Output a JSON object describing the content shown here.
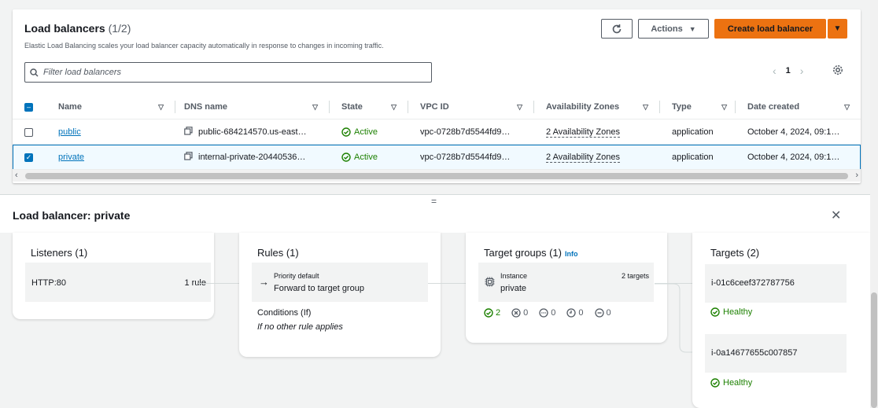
{
  "header": {
    "title": "Load balancers",
    "count": "(1/2)",
    "description": "Elastic Load Balancing scales your load balancer capacity automatically in response to changes in incoming traffic.",
    "actions_label": "Actions",
    "create_label": "Create load balancer"
  },
  "filter": {
    "placeholder": "Filter load balancers"
  },
  "pagination": {
    "current_page": "1"
  },
  "table": {
    "columns": [
      "Name",
      "DNS name",
      "State",
      "VPC ID",
      "Availability Zones",
      "Type",
      "Date created"
    ],
    "rows": [
      {
        "name": "public",
        "dns": "public-684214570.us-east…",
        "state": "Active",
        "vpc": "vpc-0728b7d5544fd9…",
        "zones": "2 Availability Zones",
        "type": "application",
        "date": "October 4, 2024, 09:1…",
        "selected": false
      },
      {
        "name": "private",
        "dns": "internal-private-20440536…",
        "state": "Active",
        "vpc": "vpc-0728b7d5544fd9…",
        "zones": "2 Availability Zones",
        "type": "application",
        "date": "October 4, 2024, 09:1…",
        "selected": true
      }
    ]
  },
  "detail": {
    "title": "Load balancer: private",
    "listeners": {
      "title": "Listeners (1)",
      "protocol": "HTTP:80",
      "rules": "1 rule"
    },
    "rules": {
      "title": "Rules (1)",
      "priority": "Priority default",
      "action": "Forward to target group",
      "conditions_label": "Conditions (If)",
      "conditions_value": "If no other rule applies"
    },
    "target_groups": {
      "title": "Target groups (1)",
      "info": "Info",
      "type": "Instance",
      "name": "private",
      "targets": "2 targets",
      "counts": {
        "healthy": "2",
        "unhealthy": "0",
        "unused": "0",
        "pending": "0",
        "draining": "0"
      }
    },
    "targets": {
      "title": "Targets (2)",
      "items": [
        {
          "id": "i-01c6ceef372787756",
          "status": "Healthy"
        },
        {
          "id": "i-0a14677655c007857",
          "status": "Healthy"
        }
      ]
    }
  },
  "colors": {
    "accent": "#ec7211",
    "link": "#0073bb",
    "success": "#1d8102"
  }
}
